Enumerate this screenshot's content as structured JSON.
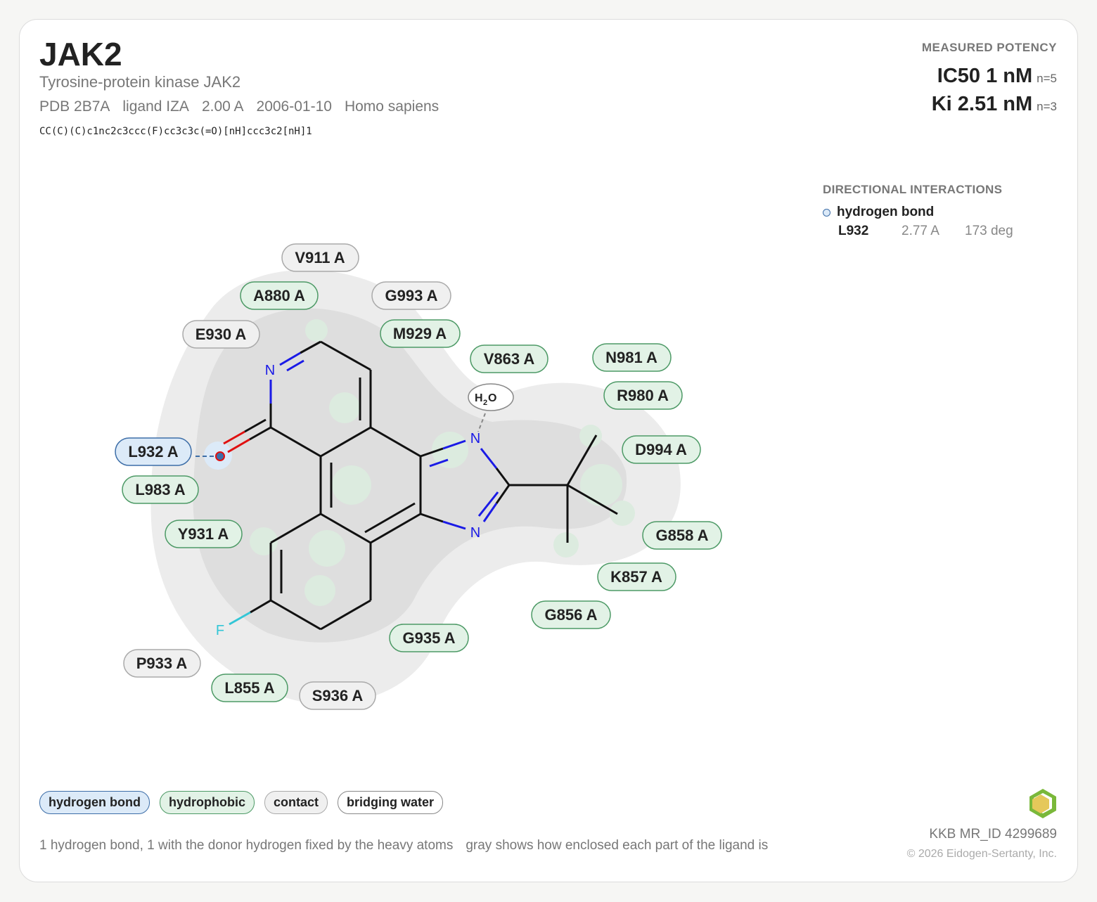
{
  "header": {
    "target": "JAK2",
    "protein_name": "Tyrosine-protein kinase JAK2",
    "pdb": "PDB 2B7A",
    "ligand": "ligand IZA",
    "resolution": "2.00 A",
    "date": "2006-01-10",
    "organism": "Homo sapiens",
    "smiles": "CC(C)(C)c1nc2c3ccc(F)cc3c3c(=O)[nH]ccc3c2[nH]1"
  },
  "potency": {
    "title": "MEASURED POTENCY",
    "ic50": "IC50 1 nM",
    "ic50_n": "n=5",
    "ki": "Ki 2.51 nM",
    "ki_n": "n=3"
  },
  "directional": {
    "title": "DIRECTIONAL INTERACTIONS",
    "kind": "hydrogen bond",
    "residue": "L932",
    "distance": "2.77 A",
    "angle": "173 deg"
  },
  "residues": {
    "V911": "V911 A",
    "A880": "A880 A",
    "G993": "G993 A",
    "E930": "E930 A",
    "M929": "M929 A",
    "V863": "V863 A",
    "N981": "N981 A",
    "R980": "R980 A",
    "D994": "D994 A",
    "L932": "L932 A",
    "L983": "L983 A",
    "Y931": "Y931 A",
    "G858": "G858 A",
    "K857": "K857 A",
    "G856": "G856 A",
    "G935": "G935 A",
    "P933": "P933 A",
    "L855": "L855 A",
    "S936": "S936 A"
  },
  "atoms": {
    "N": "N",
    "F": "F",
    "O": "O",
    "water_h": "H",
    "water_2": "2",
    "water_o": "O"
  },
  "legend": {
    "hbond": "hydrogen bond",
    "hydrophobic": "hydrophobic",
    "contact": "contact",
    "water": "bridging water"
  },
  "footer": {
    "note1": "1 hydrogen bond, 1 with the donor hydrogen fixed by the heavy atoms",
    "note2": "gray shows how enclosed each part of the ligand is",
    "mr_id": "KKB MR_ID 4299689",
    "copyright": "© 2026 Eidogen-Sertanty, Inc."
  },
  "colors": {
    "hbond_fill": "#dceaf8",
    "hbond_border": "#3d6ea8",
    "hydrophobic_fill": "#e2f2e6",
    "hydrophobic_border": "#4d9a66",
    "contact_fill": "#f0f0f0",
    "contact_border": "#aaaaaa",
    "nitrogen": "#1a1ae6",
    "oxygen": "#e01010",
    "fluorine": "#33c6d6"
  }
}
